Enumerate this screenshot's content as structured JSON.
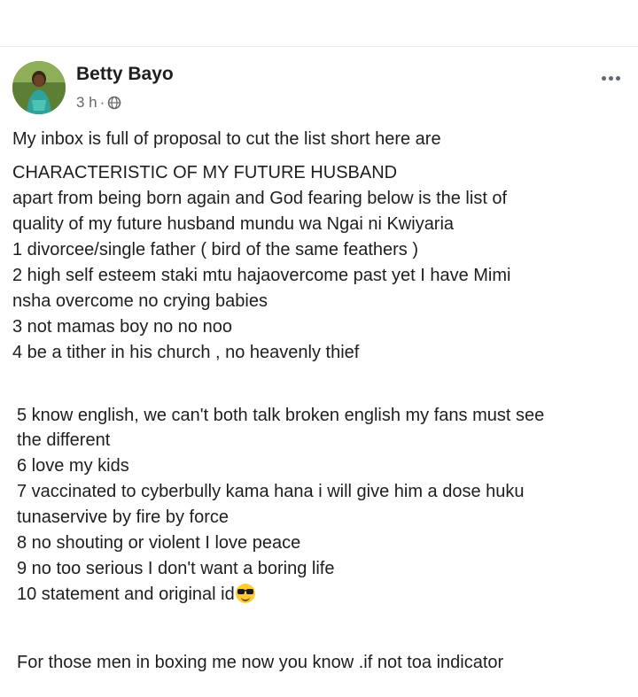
{
  "post": {
    "author": "Betty Bayo",
    "time": "3 h",
    "meta_separator": "·",
    "privacy_icon": "globe-icon",
    "more_icon": "more-options-icon",
    "lines_block1": [
      "My inbox  is full of proposal to cut the list short here are",
      "CHARACTERISTIC OF MY FUTURE HUSBAND",
      "apart from being born again and God fearing below is the list of",
      "quality of my future husband mundu wa Ngai ni Kwiyaria",
      "1 divorcee/single father ( bird of the same feathers )",
      "2 high self esteem staki mtu hajaovercome past yet I have Mimi",
      "nsha overcome no crying babies",
      "3 not mamas boy no no noo",
      "4 be a tither in his church  , no heavenly  thief"
    ],
    "lines_block2": [
      "5 know english, we can't both talk broken english my fans must see",
      "the different",
      "6 love my kids",
      "7 vaccinated to cyberbully kama hana i will give him a dose huku",
      "tunaservive by fire by force",
      "8 no shouting or violent I love peace",
      "9 no too serious I don't want a boring life",
      "10 statement  and original id"
    ],
    "emoji_icon": "sunglasses-emoji-icon",
    "closing": "For those men in boxing me now you know .if not toa indicator"
  },
  "colors": {
    "text": "#1c1e21",
    "meta": "#65676b",
    "background": "#ffffff"
  }
}
